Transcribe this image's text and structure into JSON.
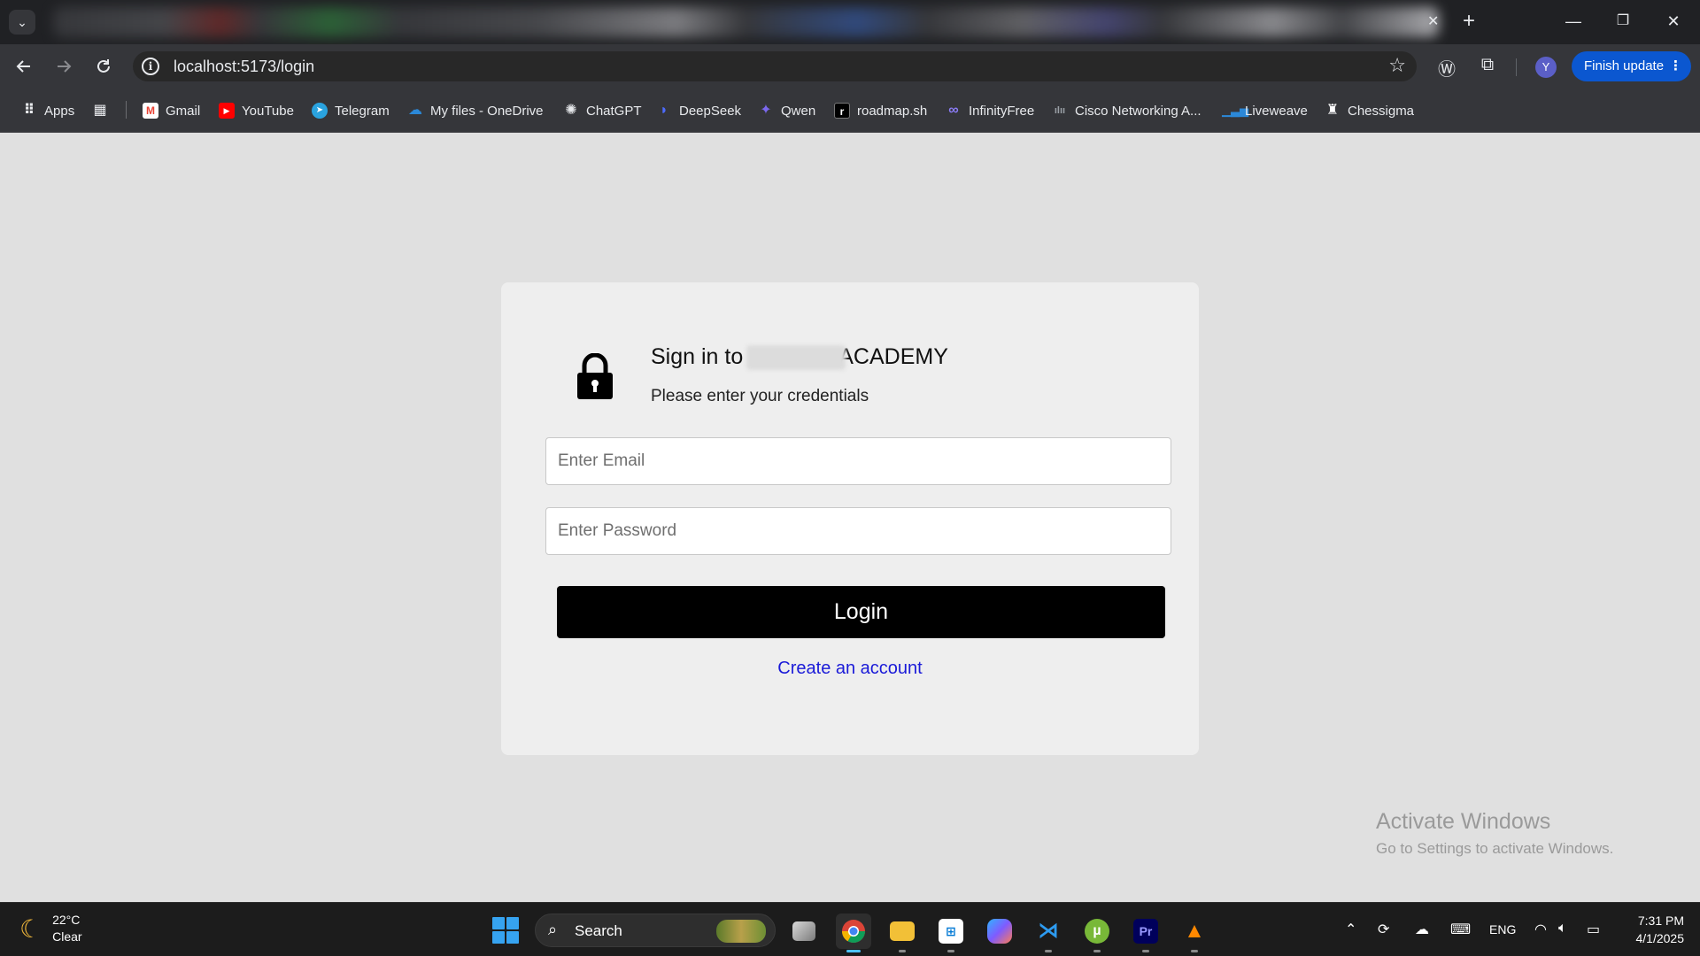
{
  "browser": {
    "url": "localhost:5173/login",
    "finish_update_label": "Finish update",
    "profile_initial": "Y",
    "window_buttons": [
      "—",
      "❐",
      "✕"
    ]
  },
  "bookmarks": [
    {
      "label": "Apps",
      "icon": "apps-grid-icon"
    },
    {
      "label": "Gmail",
      "icon": "gmail-icon"
    },
    {
      "label": "YouTube",
      "icon": "youtube-icon"
    },
    {
      "label": "Telegram",
      "icon": "telegram-icon"
    },
    {
      "label": "My files - OneDrive",
      "icon": "onedrive-icon"
    },
    {
      "label": "ChatGPT",
      "icon": "chatgpt-icon"
    },
    {
      "label": "DeepSeek",
      "icon": "deepseek-icon"
    },
    {
      "label": "Qwen",
      "icon": "qwen-icon"
    },
    {
      "label": "roadmap.sh",
      "icon": "roadmap-icon"
    },
    {
      "label": "InfinityFree",
      "icon": "infinityfree-icon"
    },
    {
      "label": "Cisco Networking A...",
      "icon": "cisco-icon"
    },
    {
      "label": "Liveweave",
      "icon": "liveweave-icon"
    },
    {
      "label": "Chessigma",
      "icon": "chessigma-icon"
    }
  ],
  "login": {
    "title_prefix": "Sign in to",
    "title_suffix": "ACADEMY",
    "subtitle": "Please enter your credentials",
    "email_placeholder": "Enter Email",
    "password_placeholder": "Enter Password",
    "login_button": "Login",
    "create_account_link": "Create an account"
  },
  "watermark": {
    "line1": "Activate Windows",
    "line2": "Go to Settings to activate Windows."
  },
  "taskbar": {
    "temperature": "22°C",
    "condition": "Clear",
    "search_label": "Search",
    "language": "ENG",
    "time": "7:31 PM",
    "date": "4/1/2025"
  }
}
